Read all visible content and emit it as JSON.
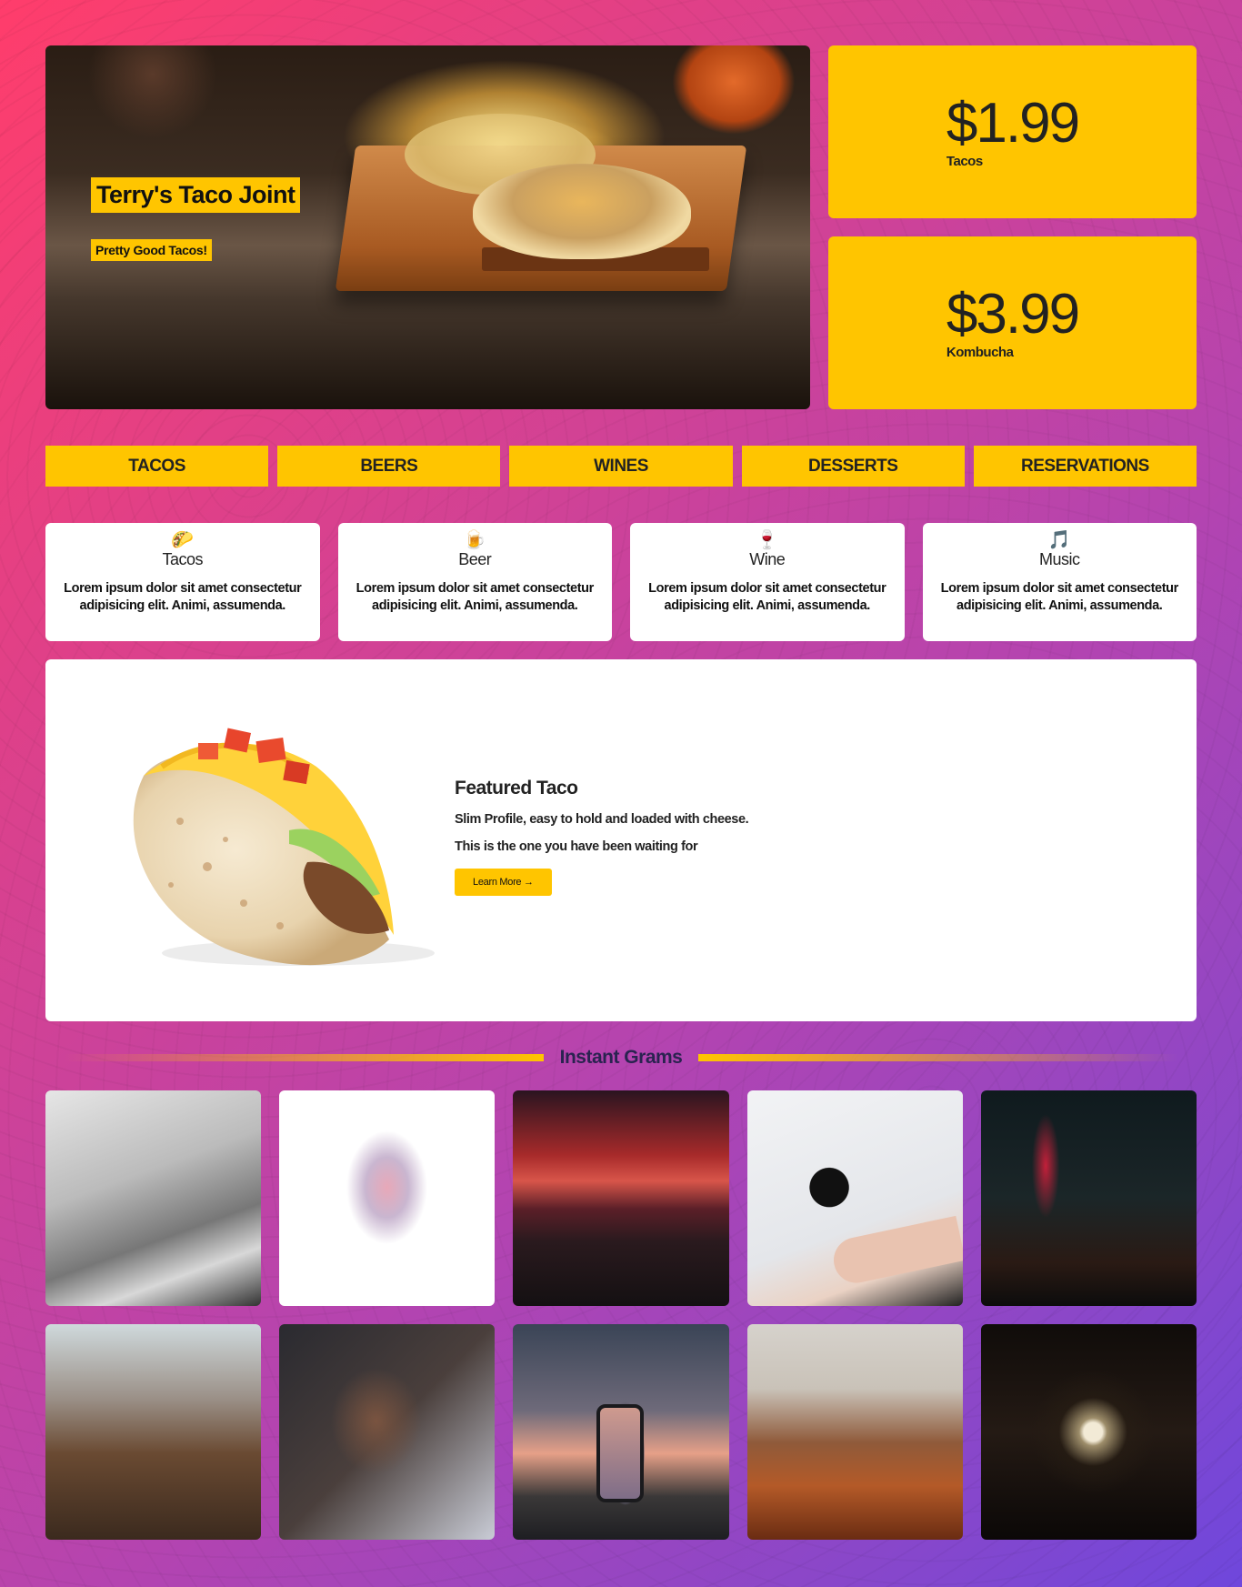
{
  "hero": {
    "title": "Terry's Taco Joint",
    "subtitle": "Pretty Good Tacos!"
  },
  "prices": [
    {
      "amount": "$1.99",
      "label": "Tacos"
    },
    {
      "amount": "$3.99",
      "label": "Kombucha"
    }
  ],
  "nav": [
    "TACOS",
    "BEERS",
    "WINES",
    "DESSERTS",
    "RESERVATIONS"
  ],
  "features": [
    {
      "icon": "🌮",
      "title": "Tacos",
      "text": "Lorem ipsum dolor sit amet consectetur adipisicing elit. Animi, assumenda."
    },
    {
      "icon": "🍺",
      "title": "Beer",
      "text": "Lorem ipsum dolor sit amet consectetur adipisicing elit. Animi, assumenda."
    },
    {
      "icon": "🍷",
      "title": "Wine",
      "text": "Lorem ipsum dolor sit amet consectetur adipisicing elit. Animi, assumenda."
    },
    {
      "icon": "🎵",
      "title": "Music",
      "text": "Lorem ipsum dolor sit amet consectetur adipisicing elit. Animi, assumenda."
    }
  ],
  "featured": {
    "title": "Featured Taco",
    "line1": "Slim Profile, easy to hold and loaded with cheese.",
    "line2": "This is the one you have been waiting for",
    "button": "Learn More →"
  },
  "grams": {
    "title": "Instant Grams",
    "photos": [
      "bathtub-photo",
      "flowers-photo",
      "sunset-lake-photo",
      "bird-on-arm-photo",
      "night-street-photo",
      "sunflower-field-photo",
      "couple-kiss-photo",
      "phone-sunset-photo",
      "foggy-forest-photo",
      "moon-photo"
    ]
  },
  "colors": {
    "accent": "#ffc500",
    "gradient_start": "#ff3d6b",
    "gradient_end": "#6f47dc"
  }
}
